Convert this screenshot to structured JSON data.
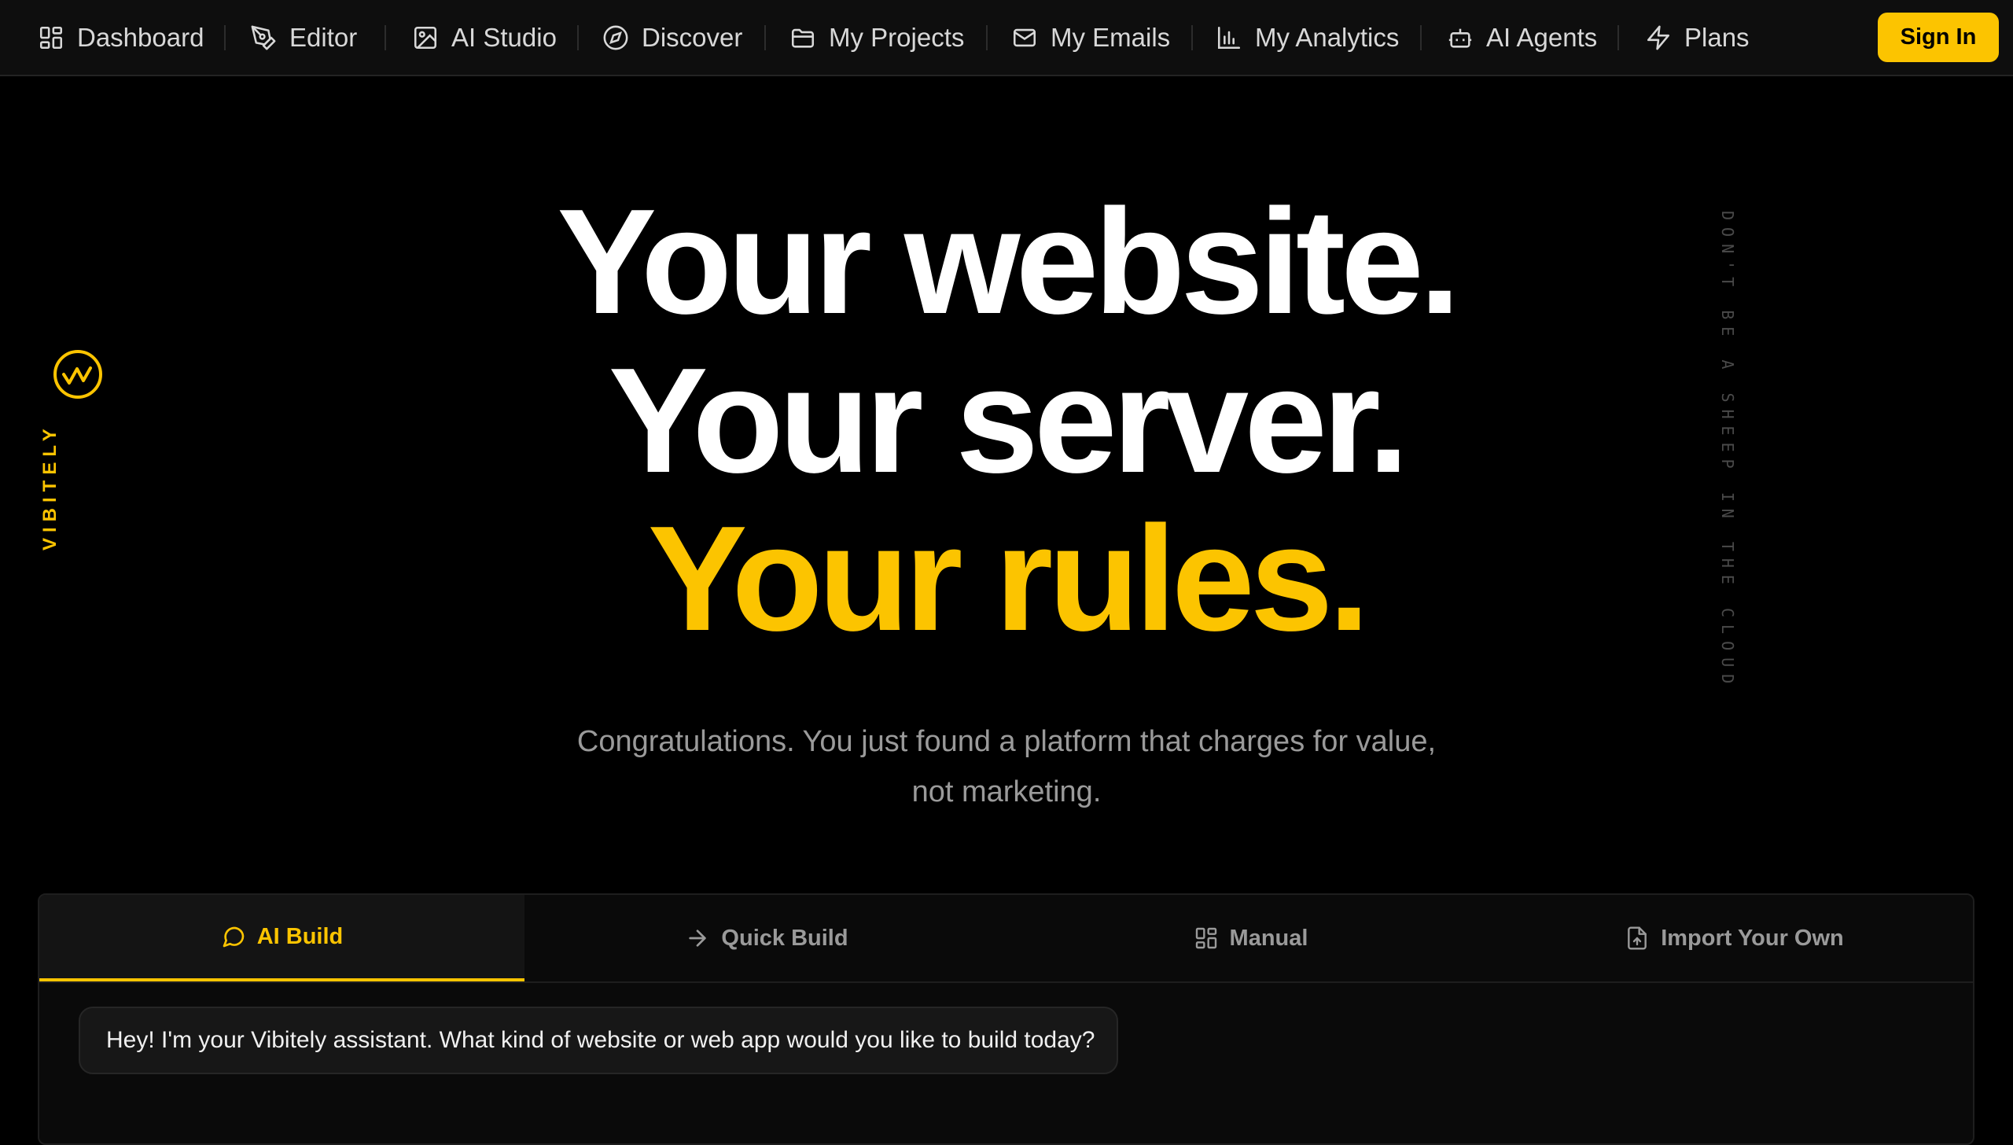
{
  "nav": {
    "items": [
      {
        "label": "Dashboard",
        "icon": "dashboard-icon"
      },
      {
        "label": "Editor",
        "icon": "pen-tool-icon"
      },
      {
        "label": "AI Studio",
        "icon": "image-icon"
      },
      {
        "label": "Discover",
        "icon": "compass-icon"
      },
      {
        "label": "My Projects",
        "icon": "folder-icon"
      },
      {
        "label": "My Emails",
        "icon": "mail-icon"
      },
      {
        "label": "My Analytics",
        "icon": "bar-chart-icon"
      },
      {
        "label": "AI Agents",
        "icon": "bot-icon"
      },
      {
        "label": "Plans",
        "icon": "zap-icon"
      }
    ],
    "sign_in_label": "Sign In"
  },
  "brand": {
    "name": "VIBITELY",
    "logo_icon": "vibitely-logo-icon"
  },
  "side_slogan": "DON'T BE A SHEEP IN THE CLOUD",
  "hero": {
    "line1": "Your website.",
    "line2": "Your server.",
    "line3": "Your rules.",
    "subtitle_line1": "Congratulations. You just found a platform that charges for value,",
    "subtitle_line2": "not marketing."
  },
  "builder": {
    "tabs": [
      {
        "label": "AI Build",
        "icon": "message-circle-icon",
        "active": true
      },
      {
        "label": "Quick Build",
        "icon": "arrow-right-icon",
        "active": false
      },
      {
        "label": "Manual",
        "icon": "grid-icon",
        "active": false
      },
      {
        "label": "Import Your Own",
        "icon": "file-upload-icon",
        "active": false
      }
    ],
    "assistant_message": "Hey! I'm your Vibitely assistant. What kind of website or web app would you like to build today?"
  },
  "colors": {
    "accent": "#fcc400",
    "background": "#000000",
    "nav_background": "#0e0e0e",
    "text_muted": "#9a9a9a"
  }
}
